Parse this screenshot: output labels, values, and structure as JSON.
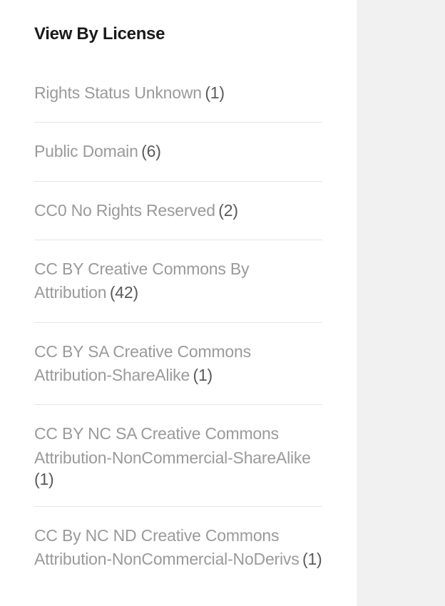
{
  "heading": "View By License",
  "licenses": [
    {
      "label": "Rights Status Unknown",
      "count": "(1)"
    },
    {
      "label": "Public Domain",
      "count": "(6)"
    },
    {
      "label": "CC0 No Rights Reserved",
      "count": "(2)"
    },
    {
      "label": "CC BY Creative Commons By Attribution",
      "count": "(42)"
    },
    {
      "label": "CC BY SA Creative Commons Attribution-ShareAlike",
      "count": "(1)"
    },
    {
      "label": "CC BY NC SA Creative Commons Attribution-NonCommercial-ShareAlike",
      "count": "(1)"
    },
    {
      "label": "CC By NC ND Creative Commons Attribution-NonCommercial-NoDerivs",
      "count": "(1)"
    }
  ]
}
